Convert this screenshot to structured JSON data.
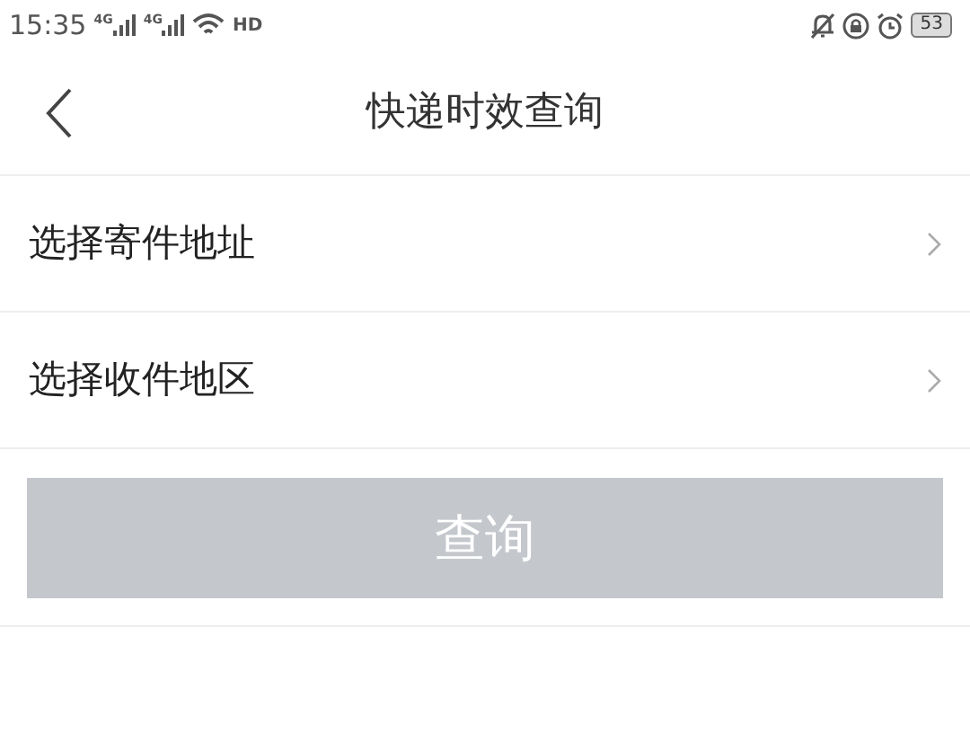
{
  "status_bar": {
    "time": "15:35",
    "sim_labels": [
      "4G",
      "4G"
    ],
    "hd_label": "HD",
    "battery": "53"
  },
  "header": {
    "title": "快递时效查询"
  },
  "rows": [
    {
      "label": "选择寄件地址"
    },
    {
      "label": "选择收件地区"
    }
  ],
  "query_button": {
    "label": "查询",
    "disabled": true
  }
}
